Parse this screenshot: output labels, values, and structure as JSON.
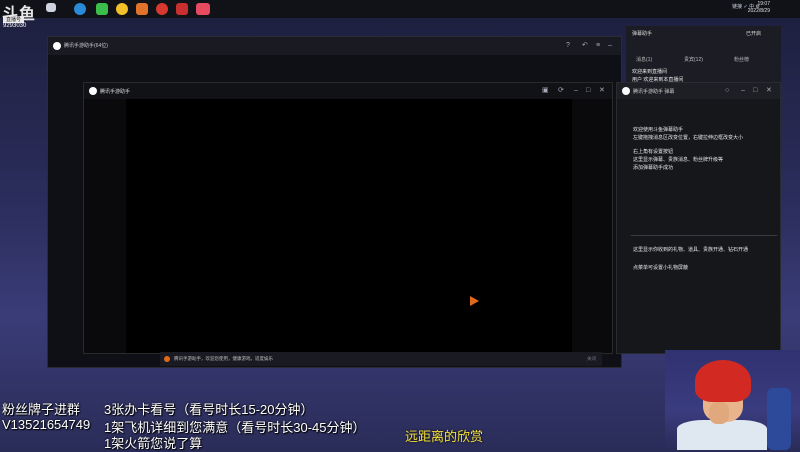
{
  "logo": {
    "text": "斗鱼",
    "tag": "直播号",
    "room_id": "9293030"
  },
  "taskbar": {
    "tray_text": "链接 ✓ 中 ⚙",
    "time": "19:07",
    "date": "2022/8/29"
  },
  "main_window": {
    "title": "腾讯手游助手(64位)"
  },
  "inner_window": {
    "title": "腾讯手游助手"
  },
  "status_bar": {
    "text": "腾讯手游助手，欢迎您使用，健康游戏，适度娱乐",
    "right": "关闭"
  },
  "danmaku_panel": {
    "title": "弹幕助手",
    "status": "已开启",
    "tabs": [
      "消息(1)",
      "粉丝榜",
      "贵宾(12)"
    ],
    "lines": [
      "欢迎来到直播间",
      "用户 欢迎来到本直播间"
    ]
  },
  "chat_window": {
    "title": "腾讯手游助手 弹幕",
    "messages": [
      "欢迎使用斗鱼弹幕助手",
      "左键拖拽消息区改变位置，右键拉伸边框改变大小",
      "右上角有设置按钮",
      "这里显示弹幕、贵族消息、粉丝牌升级等",
      "添加弹幕助手成功",
      "这里显示你收到的礼物、道具、贵族开通、钻石开通",
      "点菜单可设置小礼物屏蔽"
    ]
  },
  "overlay": {
    "left_lines": [
      "粉丝牌子进群",
      "V13521654749"
    ],
    "mid_lines": [
      "3张办卡看号（看号时长15-20分钟）",
      "1架飞机详细到您满意（看号时长30-45分钟）",
      "1架火箭您说了算"
    ],
    "yellow": "远距离的欣赏"
  },
  "colors": {
    "accent_orange": "#e06a1a",
    "overlay_yellow": "#f5e23a",
    "hair_red": "#d22a22"
  }
}
